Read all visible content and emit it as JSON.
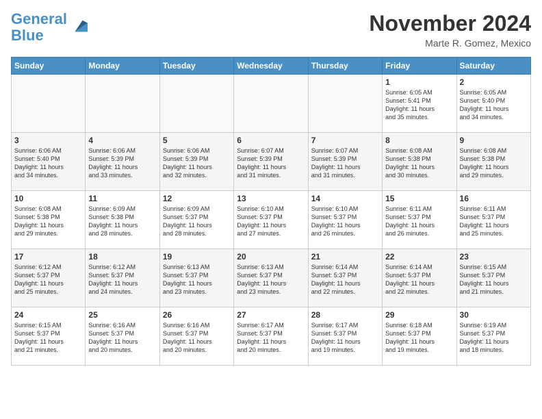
{
  "header": {
    "logo_line1": "General",
    "logo_line2": "Blue",
    "month": "November 2024",
    "location": "Marte R. Gomez, Mexico"
  },
  "days_of_week": [
    "Sunday",
    "Monday",
    "Tuesday",
    "Wednesday",
    "Thursday",
    "Friday",
    "Saturday"
  ],
  "weeks": [
    [
      {
        "day": "",
        "info": ""
      },
      {
        "day": "",
        "info": ""
      },
      {
        "day": "",
        "info": ""
      },
      {
        "day": "",
        "info": ""
      },
      {
        "day": "",
        "info": ""
      },
      {
        "day": "1",
        "info": "Sunrise: 6:05 AM\nSunset: 5:41 PM\nDaylight: 11 hours\nand 35 minutes."
      },
      {
        "day": "2",
        "info": "Sunrise: 6:05 AM\nSunset: 5:40 PM\nDaylight: 11 hours\nand 34 minutes."
      }
    ],
    [
      {
        "day": "3",
        "info": "Sunrise: 6:06 AM\nSunset: 5:40 PM\nDaylight: 11 hours\nand 34 minutes."
      },
      {
        "day": "4",
        "info": "Sunrise: 6:06 AM\nSunset: 5:39 PM\nDaylight: 11 hours\nand 33 minutes."
      },
      {
        "day": "5",
        "info": "Sunrise: 6:06 AM\nSunset: 5:39 PM\nDaylight: 11 hours\nand 32 minutes."
      },
      {
        "day": "6",
        "info": "Sunrise: 6:07 AM\nSunset: 5:39 PM\nDaylight: 11 hours\nand 31 minutes."
      },
      {
        "day": "7",
        "info": "Sunrise: 6:07 AM\nSunset: 5:39 PM\nDaylight: 11 hours\nand 31 minutes."
      },
      {
        "day": "8",
        "info": "Sunrise: 6:08 AM\nSunset: 5:38 PM\nDaylight: 11 hours\nand 30 minutes."
      },
      {
        "day": "9",
        "info": "Sunrise: 6:08 AM\nSunset: 5:38 PM\nDaylight: 11 hours\nand 29 minutes."
      }
    ],
    [
      {
        "day": "10",
        "info": "Sunrise: 6:08 AM\nSunset: 5:38 PM\nDaylight: 11 hours\nand 29 minutes."
      },
      {
        "day": "11",
        "info": "Sunrise: 6:09 AM\nSunset: 5:38 PM\nDaylight: 11 hours\nand 28 minutes."
      },
      {
        "day": "12",
        "info": "Sunrise: 6:09 AM\nSunset: 5:37 PM\nDaylight: 11 hours\nand 28 minutes."
      },
      {
        "day": "13",
        "info": "Sunrise: 6:10 AM\nSunset: 5:37 PM\nDaylight: 11 hours\nand 27 minutes."
      },
      {
        "day": "14",
        "info": "Sunrise: 6:10 AM\nSunset: 5:37 PM\nDaylight: 11 hours\nand 26 minutes."
      },
      {
        "day": "15",
        "info": "Sunrise: 6:11 AM\nSunset: 5:37 PM\nDaylight: 11 hours\nand 26 minutes."
      },
      {
        "day": "16",
        "info": "Sunrise: 6:11 AM\nSunset: 5:37 PM\nDaylight: 11 hours\nand 25 minutes."
      }
    ],
    [
      {
        "day": "17",
        "info": "Sunrise: 6:12 AM\nSunset: 5:37 PM\nDaylight: 11 hours\nand 25 minutes."
      },
      {
        "day": "18",
        "info": "Sunrise: 6:12 AM\nSunset: 5:37 PM\nDaylight: 11 hours\nand 24 minutes."
      },
      {
        "day": "19",
        "info": "Sunrise: 6:13 AM\nSunset: 5:37 PM\nDaylight: 11 hours\nand 23 minutes."
      },
      {
        "day": "20",
        "info": "Sunrise: 6:13 AM\nSunset: 5:37 PM\nDaylight: 11 hours\nand 23 minutes."
      },
      {
        "day": "21",
        "info": "Sunrise: 6:14 AM\nSunset: 5:37 PM\nDaylight: 11 hours\nand 22 minutes."
      },
      {
        "day": "22",
        "info": "Sunrise: 6:14 AM\nSunset: 5:37 PM\nDaylight: 11 hours\nand 22 minutes."
      },
      {
        "day": "23",
        "info": "Sunrise: 6:15 AM\nSunset: 5:37 PM\nDaylight: 11 hours\nand 21 minutes."
      }
    ],
    [
      {
        "day": "24",
        "info": "Sunrise: 6:15 AM\nSunset: 5:37 PM\nDaylight: 11 hours\nand 21 minutes."
      },
      {
        "day": "25",
        "info": "Sunrise: 6:16 AM\nSunset: 5:37 PM\nDaylight: 11 hours\nand 20 minutes."
      },
      {
        "day": "26",
        "info": "Sunrise: 6:16 AM\nSunset: 5:37 PM\nDaylight: 11 hours\nand 20 minutes."
      },
      {
        "day": "27",
        "info": "Sunrise: 6:17 AM\nSunset: 5:37 PM\nDaylight: 11 hours\nand 20 minutes."
      },
      {
        "day": "28",
        "info": "Sunrise: 6:17 AM\nSunset: 5:37 PM\nDaylight: 11 hours\nand 19 minutes."
      },
      {
        "day": "29",
        "info": "Sunrise: 6:18 AM\nSunset: 5:37 PM\nDaylight: 11 hours\nand 19 minutes."
      },
      {
        "day": "30",
        "info": "Sunrise: 6:19 AM\nSunset: 5:37 PM\nDaylight: 11 hours\nand 18 minutes."
      }
    ]
  ]
}
